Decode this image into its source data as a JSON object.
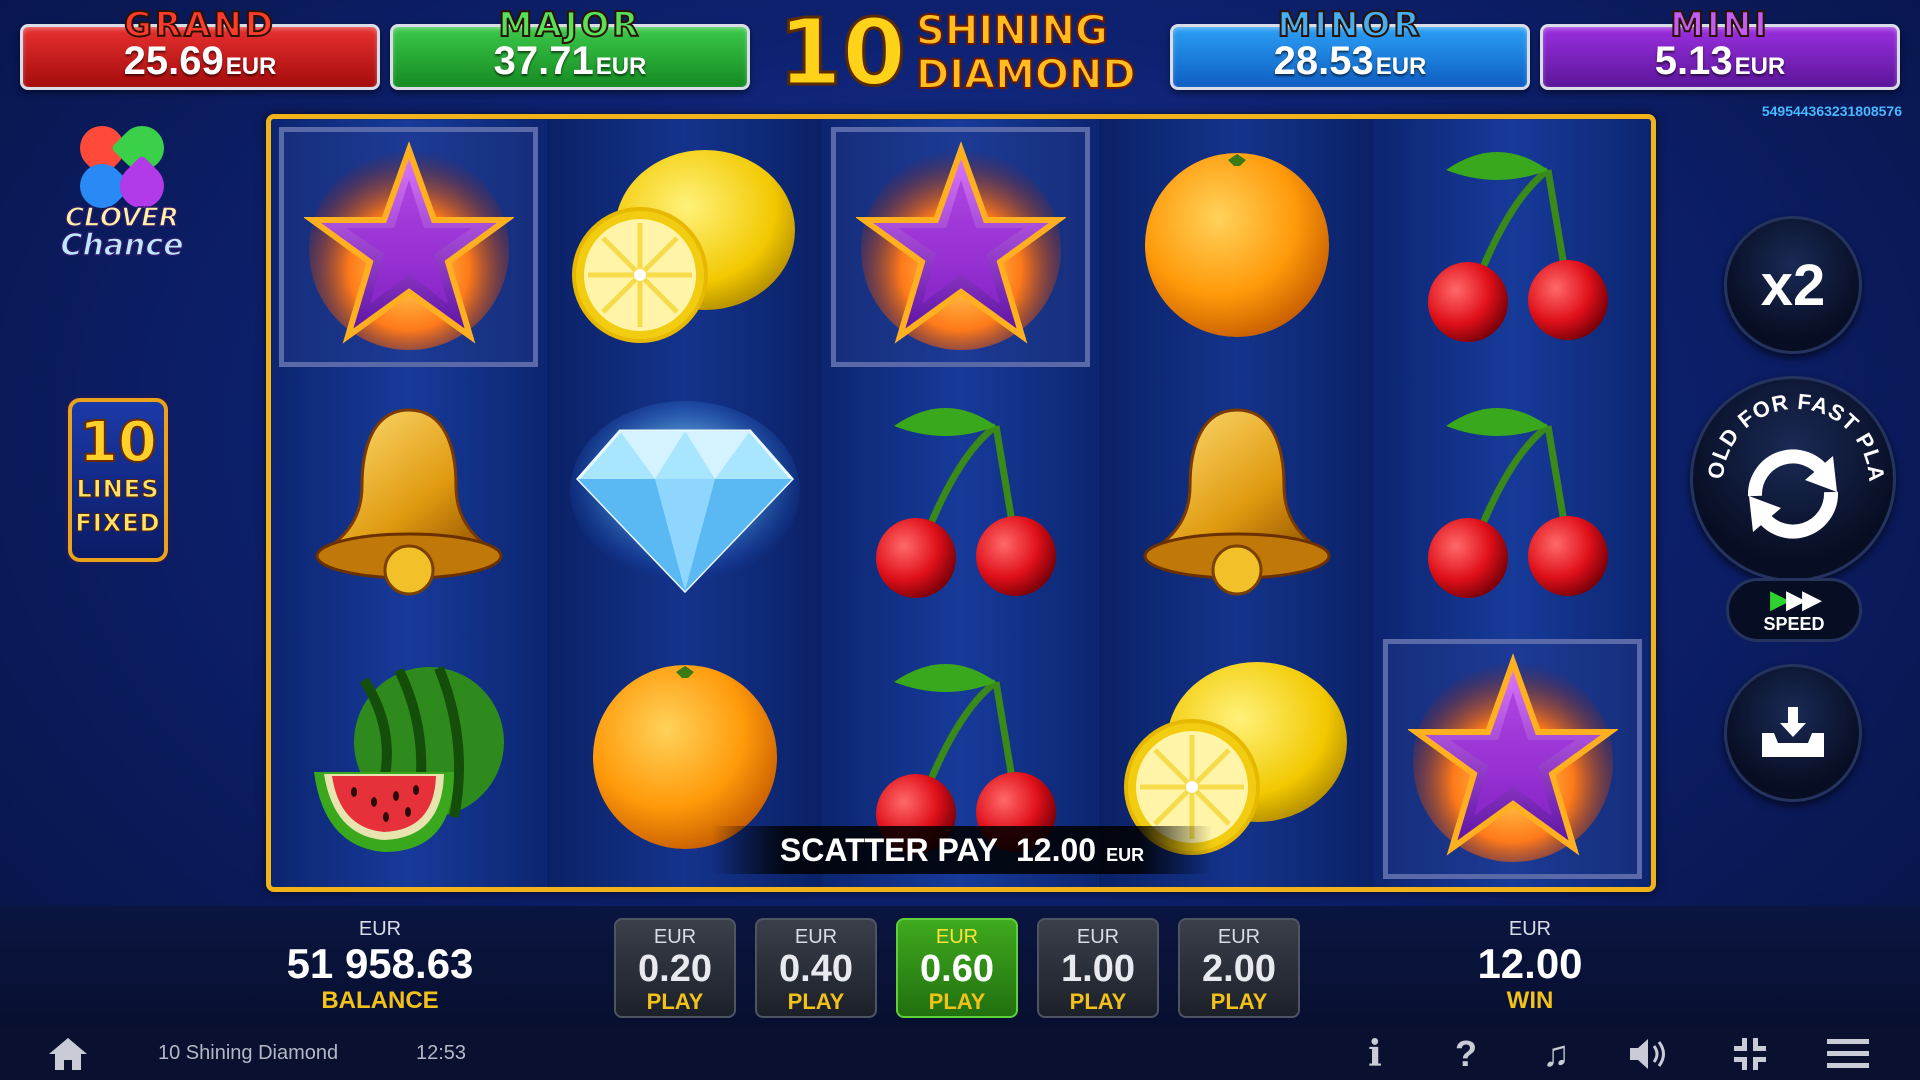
{
  "jackpots": {
    "grand": {
      "title": "GRAND",
      "value": "25.69",
      "currency": "EUR"
    },
    "major": {
      "title": "MAJOR",
      "value": "37.71",
      "currency": "EUR"
    },
    "minor": {
      "title": "MINOR",
      "value": "28.53",
      "currency": "EUR"
    },
    "mini": {
      "title": "MINI",
      "value": "5.13",
      "currency": "EUR"
    }
  },
  "logo": {
    "number": "10",
    "line1": "SHINING",
    "line2": "DIAMOND"
  },
  "session_id": "549544363231808576",
  "clover": {
    "line1": "CLOVER",
    "line2": "Chance"
  },
  "lines_badge": {
    "number": "10",
    "line1": "LINES",
    "line2": "FIXED"
  },
  "reels": [
    [
      "star",
      "bell",
      "watermelon"
    ],
    [
      "lemon",
      "diamond",
      "orange"
    ],
    [
      "star",
      "cherry",
      "cherry"
    ],
    [
      "orange",
      "bell",
      "lemon"
    ],
    [
      "cherry",
      "cherry",
      "star"
    ]
  ],
  "scatter": {
    "label": "SCATTER PAY",
    "amount": "12.00",
    "currency": "EUR"
  },
  "controls": {
    "multiplier": "x2",
    "spin_hint": "HOLD FOR FAST PLAY",
    "speed_label": "SPEED"
  },
  "balance": {
    "currency": "EUR",
    "value": "51 958.63",
    "label": "BALANCE"
  },
  "bets": [
    {
      "currency": "EUR",
      "value": "0.20",
      "label": "PLAY",
      "active": false
    },
    {
      "currency": "EUR",
      "value": "0.40",
      "label": "PLAY",
      "active": false
    },
    {
      "currency": "EUR",
      "value": "0.60",
      "label": "PLAY",
      "active": true
    },
    {
      "currency": "EUR",
      "value": "1.00",
      "label": "PLAY",
      "active": false
    },
    {
      "currency": "EUR",
      "value": "2.00",
      "label": "PLAY",
      "active": false
    }
  ],
  "win": {
    "currency": "EUR",
    "value": "12.00",
    "label": "WIN"
  },
  "footer": {
    "game_name": "10 Shining Diamond",
    "time": "12:53",
    "icons": [
      "home-icon",
      "info-icon",
      "help-icon",
      "music-icon",
      "sound-icon",
      "fullscreen-icon",
      "menu-icon"
    ]
  },
  "colors": {
    "accent_gold": "#f3c21a",
    "active_bet": "#3faa1e",
    "reel_frame": "#f2b21a"
  }
}
